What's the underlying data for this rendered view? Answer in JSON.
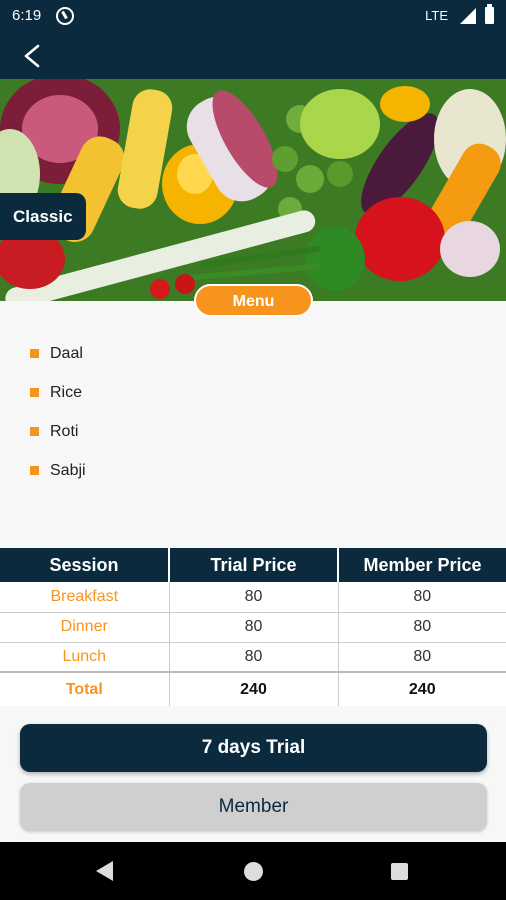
{
  "status_bar": {
    "time": "6:19",
    "network": "LTE"
  },
  "plan": {
    "name": "Classic"
  },
  "menu": {
    "title": "Menu",
    "items": [
      "Daal",
      "Rice",
      "Roti",
      "Sabji"
    ]
  },
  "price_table": {
    "headers": [
      "Session",
      "Trial Price",
      "Member Price"
    ],
    "rows": [
      {
        "session": "Breakfast",
        "trial": "80",
        "member": "80"
      },
      {
        "session": "Dinner",
        "trial": "80",
        "member": "80"
      },
      {
        "session": "Lunch",
        "trial": "80",
        "member": "80"
      }
    ],
    "total": {
      "session": "Total",
      "trial": "240",
      "member": "240"
    }
  },
  "actions": {
    "trial_label": "7 days Trial",
    "member_label": "Member"
  },
  "colors": {
    "primary": "#0b2a3e",
    "accent": "#f7941d"
  },
  "icons": {
    "back": "back-arrow-icon",
    "alert": "alert-circle-icon"
  }
}
